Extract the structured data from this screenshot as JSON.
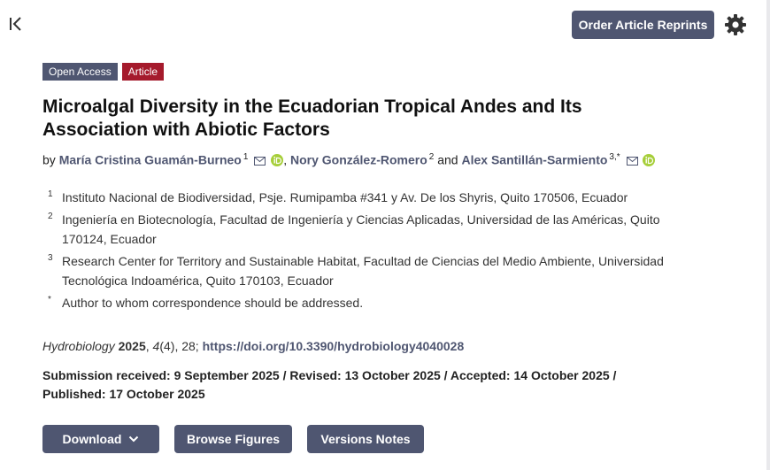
{
  "header": {
    "reprints_label": "Order Article Reprints"
  },
  "badges": {
    "open_access": "Open Access",
    "article": "Article"
  },
  "article": {
    "title": "Microalgal Diversity in the Ecuadorian Tropical Andes and Its Association with Abiotic Factors",
    "by_label": "by",
    "authors": [
      {
        "name": "María Cristina Guamán-Burneo",
        "sup": "1"
      },
      {
        "name": "Nory González-Romero",
        "sup": "2"
      },
      {
        "name": "Alex Santillán-Sarmiento",
        "sup": "3,*"
      }
    ],
    "and_label": "and",
    "affiliations": [
      {
        "num": "1",
        "text": "Instituto Nacional de Biodiversidad, Psje. Rumipamba #341 y Av. De los Shyris, Quito 170506, Ecuador"
      },
      {
        "num": "2",
        "text": "Ingeniería en Biotecnología, Facultad de Ingeniería y Ciencias Aplicadas, Universidad de las Américas, Quito 170124, Ecuador"
      },
      {
        "num": "3",
        "text": "Research Center for Territory and Sustainable Habitat, Facultad de Ciencias del Medio Ambiente, Universidad Tecnológica Indoamérica, Quito 170103, Ecuador"
      },
      {
        "num": "*",
        "text": "Author to whom correspondence should be addressed."
      }
    ],
    "citation": {
      "journal": "Hydrobiology",
      "year": "2025",
      "volume": "4",
      "issue_pages": "(4), 28;",
      "doi": "https://doi.org/10.3390/hydrobiology4040028"
    },
    "dates": "Submission received: 9 September 2025 / Revised: 13 October 2025 / Accepted: 14 October 2025 / Published: 17 October 2025"
  },
  "actions": {
    "download": "Download",
    "browse_figures": "Browse Figures",
    "versions_notes": "Versions Notes"
  },
  "icons": {
    "collapse": "collapse-left-icon",
    "settings": "gear-icon",
    "mail": "mail-icon",
    "orcid": "orcid-icon",
    "chevron": "chevron-down-icon"
  },
  "colors": {
    "primary": "#4f5671",
    "article_badge": "#a51a2c",
    "orcid": "#a6ce39"
  }
}
